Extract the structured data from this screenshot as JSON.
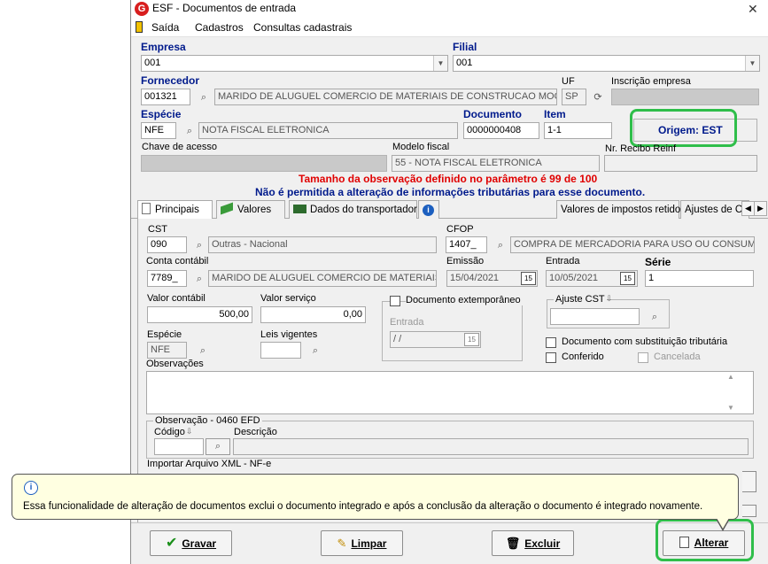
{
  "window": {
    "title": "ESF - Documentos de entrada",
    "close_glyph": "✕"
  },
  "menu": {
    "items": [
      "Saída",
      "Cadastros",
      "Consultas cadastrais"
    ]
  },
  "header": {
    "empresa_label": "Empresa",
    "empresa_value": "001",
    "filial_label": "Filial",
    "filial_value": "001",
    "fornecedor_label": "Fornecedor",
    "fornecedor_code": "001321",
    "fornecedor_name": "MARIDO DE ALUGUEL COMERCIO DE MATERIAIS DE CONSTRUCAO MOGI",
    "uf_label": "UF",
    "uf_value": "SP",
    "inscricao_label": "Inscrição empresa",
    "especie_label": "Espécie",
    "especie_code": "NFE",
    "especie_name": "NOTA FISCAL ELETRONICA",
    "documento_label": "Documento",
    "documento_value": "0000000408",
    "item_label": "Item",
    "item_value": "1-1",
    "origem_text": "Origem: EST",
    "chave_label": "Chave de acesso",
    "modelo_label": "Modelo fiscal",
    "modelo_value": "55 - NOTA FISCAL ELETRONICA",
    "recibo_label": "Nr. Recibo Reinf"
  },
  "messages": {
    "red": "Tamanho da observação definido no parâmetro é 99 de 100",
    "blue": "Não é permitida a alteração de informações tributárias para esse documento."
  },
  "tabs": {
    "principais": "Principais",
    "valores": "Valores",
    "transportador": "Dados do transportador",
    "impostos": "Valores de impostos retidos",
    "ajustes": "Ajustes de C"
  },
  "principais": {
    "cst_label": "CST",
    "cst_code": "090",
    "cst_desc": "Outras - Nacional",
    "cfop_label": "CFOP",
    "cfop_code": "1407_",
    "cfop_desc": "COMPRA DE MERCADORIA PARA USO OU CONSUMO",
    "conta_label": "Conta contábil",
    "conta_code": "7789_",
    "conta_desc": "MARIDO DE ALUGUEL COMERCIO DE MATERIAIS",
    "emissao_label": "Emissão",
    "emissao_value": "15/04/2021",
    "entrada_label": "Entrada",
    "entrada_value": "10/05/2021",
    "serie_label": "Série",
    "serie_value": "1",
    "valor_contabil_label": "Valor contábil",
    "valor_contabil_value": "500,00",
    "valor_servico_label": "Valor serviço",
    "valor_servico_value": "0,00",
    "doc_extemporaneo_label": "Documento extemporâneo",
    "entrada2_label": "Entrada",
    "entrada2_value": " /  /",
    "ajuste_cst_label": "Ajuste CST",
    "especie_label": "Espécie",
    "especie_value": "NFE",
    "leis_label": "Leis vigentes",
    "subst_label": "Documento com substituição tributária",
    "conferido_label": "Conferido",
    "cancelada_label": "Cancelada",
    "observacoes_label": "Observações",
    "obs_efd_label": "Observação - 0460 EFD",
    "codigo_label": "Código",
    "descricao_label": "Descrição",
    "importar_label": "Importar Arquivo XML - NF-e"
  },
  "tooltip": {
    "text": "Essa funcionalidade de alteração de documentos exclui o documento integrado e após a conclusão da alteração o documento é integrado novamente."
  },
  "buttons": {
    "gravar": "Gravar",
    "limpar": "Limpar",
    "excluir": "Excluir",
    "alterar": "Alterar"
  },
  "colors": {
    "highlight": "#2fbe4a",
    "label_blue": "#001a8c",
    "warning_red": "#e00000",
    "tooltip_bg": "#ffffe1"
  }
}
